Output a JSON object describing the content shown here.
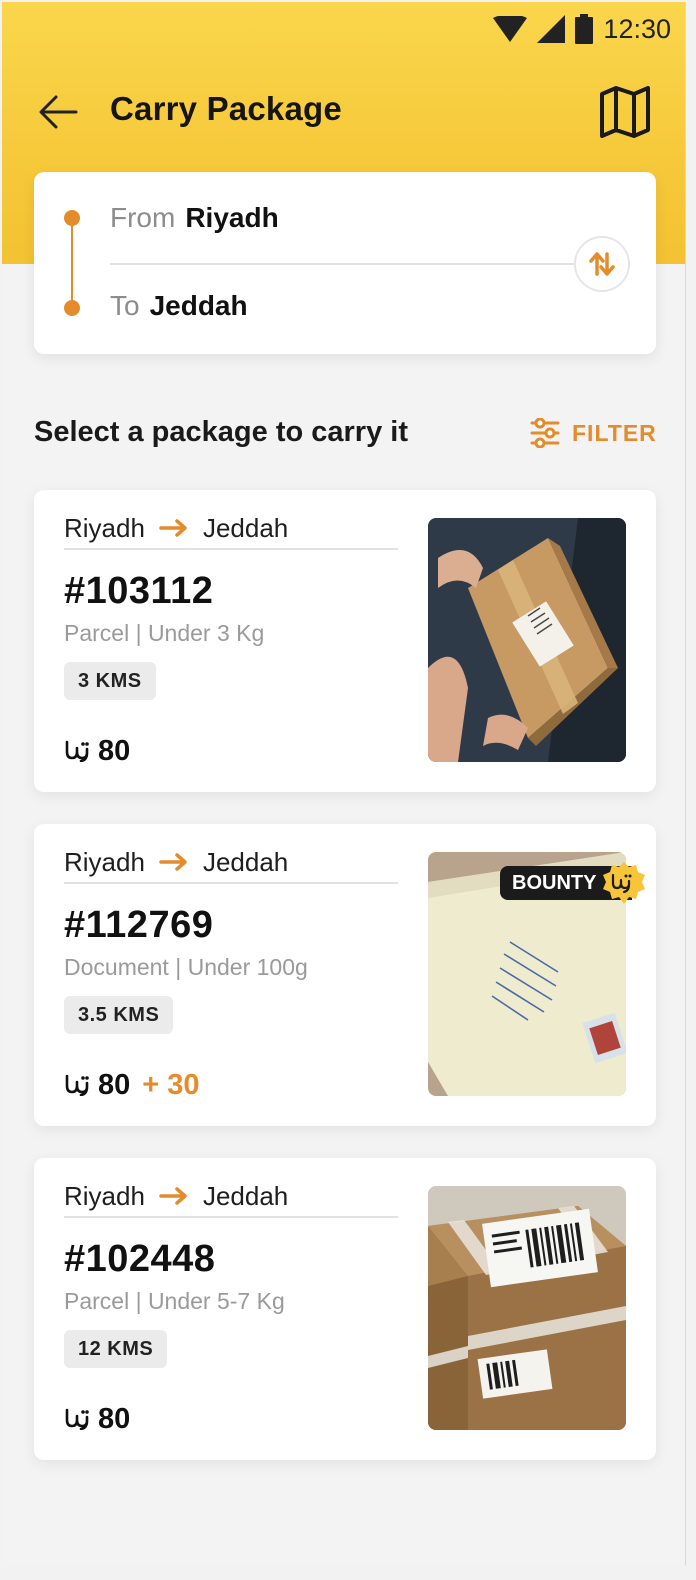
{
  "status_bar": {
    "time": "12:30"
  },
  "app_bar": {
    "title": "Carry Package"
  },
  "route": {
    "from_label": "From",
    "from_value": "Riyadh",
    "to_label": "To",
    "to_value": "Jeddah"
  },
  "list": {
    "title": "Select a package to carry it",
    "filter_label": "FILTER"
  },
  "currency_icon": "riyal-icon",
  "colors": {
    "accent": "#e48b2b",
    "header": "#f6c93a"
  },
  "packages": [
    {
      "from": "Riyadh",
      "to": "Jeddah",
      "id": "#103112",
      "desc": "Parcel | Under 3 Kg",
      "distance": "3 KMS",
      "price": "80",
      "bonus": "",
      "bounty_label": "",
      "image": "parcel-box-held-image"
    },
    {
      "from": "Riyadh",
      "to": "Jeddah",
      "id": "#112769",
      "desc": "Document | Under 100g",
      "distance": "3.5 KMS",
      "price": "80",
      "bonus": "+ 30",
      "bounty_label": "BOUNTY",
      "image": "envelope-document-image"
    },
    {
      "from": "Riyadh",
      "to": "Jeddah",
      "id": "#102448",
      "desc": "Parcel | Under 5-7 Kg",
      "distance": "12 KMS",
      "price": "80",
      "bonus": "",
      "bounty_label": "",
      "image": "taped-box-image"
    }
  ]
}
